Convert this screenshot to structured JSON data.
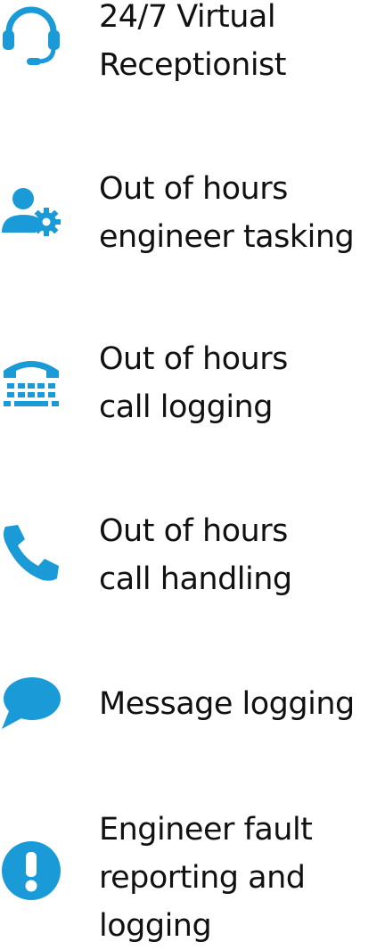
{
  "accent_color": "#1a9ad6",
  "features": [
    {
      "icon": "headset-icon",
      "lines": [
        "24/7 Virtual",
        "Receptionist"
      ]
    },
    {
      "icon": "user-gear-icon",
      "lines": [
        "Out of hours",
        "engineer tasking"
      ]
    },
    {
      "icon": "telephone-keypad-icon",
      "lines": [
        "Out of hours",
        "call logging"
      ]
    },
    {
      "icon": "phone-handset-icon",
      "lines": [
        "Out of hours",
        "call handling"
      ]
    },
    {
      "icon": "chat-bubble-icon",
      "lines": [
        "Message logging"
      ]
    },
    {
      "icon": "exclamation-circle-icon",
      "lines": [
        "Engineer fault",
        "reporting and",
        "logging"
      ]
    }
  ]
}
